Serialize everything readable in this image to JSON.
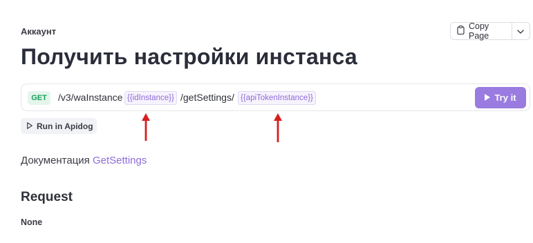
{
  "breadcrumb": "Аккаунт",
  "copy_page": {
    "label": "Copy Page"
  },
  "title": "Получить настройки инстанса",
  "endpoint": {
    "method": "GET",
    "path_part_1": "/v3/waInstance",
    "param_1": "{{idInstance}}",
    "path_part_2": "/getSettings/",
    "param_2": "{{apiTokenInstance}}",
    "try_label": "Try it"
  },
  "run_in_apidog": "Run in Apidog",
  "documentation": {
    "label": "Документация",
    "link": "GetSettings"
  },
  "request": {
    "title": "Request",
    "value": "None"
  },
  "colors": {
    "accent": "#9a7be0",
    "method_get": "#18a15c",
    "arrow": "#d81e1e"
  }
}
